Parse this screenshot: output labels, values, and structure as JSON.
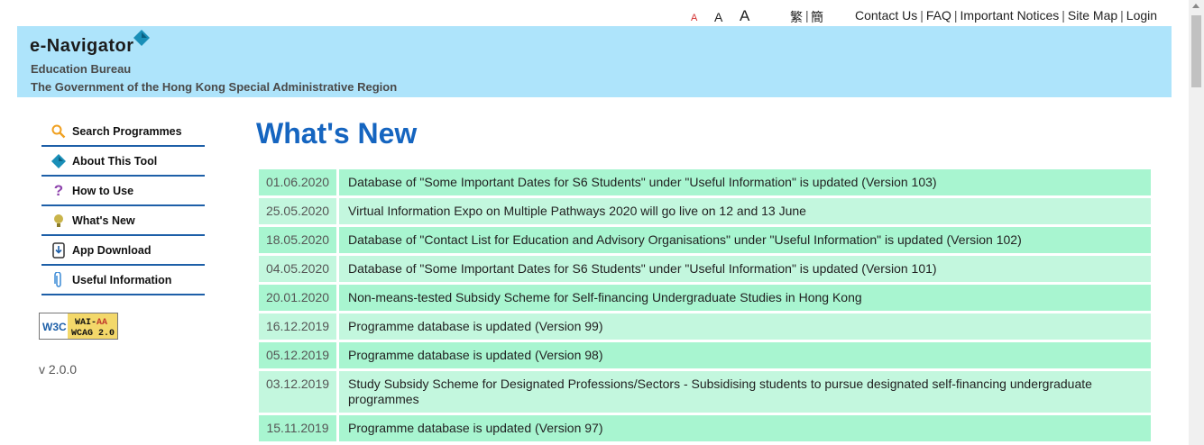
{
  "topbar": {
    "font_small": "A",
    "font_medium": "A",
    "font_large": "A",
    "lang_traditional": "繁",
    "lang_separator": "|",
    "lang_simplified": "簡",
    "links": [
      "Contact Us",
      "FAQ",
      "Important Notices",
      "Site Map",
      "Login"
    ]
  },
  "header": {
    "logo_text": "e-Navigator",
    "org_line1": "Education Bureau",
    "org_line2": "The Government of the Hong Kong Special Administrative Region",
    "colors": {
      "banner": "#aee4fb"
    }
  },
  "sidebar": {
    "items": [
      {
        "label": "Search Programmes",
        "icon": "magnifier-icon"
      },
      {
        "label": "About This Tool",
        "icon": "navigator-icon"
      },
      {
        "label": "How to Use",
        "icon": "question-icon"
      },
      {
        "label": "What's New",
        "icon": "lightbulb-icon"
      },
      {
        "label": "App Download",
        "icon": "mobile-download-icon"
      },
      {
        "label": "Useful Information",
        "icon": "paperclip-icon"
      }
    ],
    "badge_text": "W3C WAI-AA WCAG 2.0",
    "version": "v 2.0.0"
  },
  "main": {
    "title": "What's New",
    "news": [
      {
        "date": "01.06.2020",
        "text": "Database of \"Some Important Dates for S6 Students\" under \"Useful Information\" is updated (Version 103)"
      },
      {
        "date": "25.05.2020",
        "text": "Virtual Information Expo on Multiple Pathways 2020 will go live on 12 and 13 June"
      },
      {
        "date": "18.05.2020",
        "text": "Database of \"Contact List for Education and Advisory Organisations\" under \"Useful Information\" is updated (Version 102)"
      },
      {
        "date": "04.05.2020",
        "text": "Database of \"Some Important Dates for S6 Students\" under \"Useful Information\" is updated (Version 101)"
      },
      {
        "date": "20.01.2020",
        "text": "Non-means-tested Subsidy Scheme for Self-financing Undergraduate Studies in Hong Kong"
      },
      {
        "date": "16.12.2019",
        "text": "Programme database is updated (Version 99)"
      },
      {
        "date": "05.12.2019",
        "text": "Programme database is updated (Version 98)"
      },
      {
        "date": "03.12.2019",
        "text": "Study Subsidy Scheme for Designated Professions/Sectors - Subsidising students to pursue designated self-financing undergraduate programmes"
      },
      {
        "date": "15.11.2019",
        "text": "Programme database is updated (Version 97)"
      }
    ],
    "colors": {
      "title": "#1565c0",
      "row_light": "#c3f7de",
      "row_dark": "#a8f5d0"
    }
  }
}
